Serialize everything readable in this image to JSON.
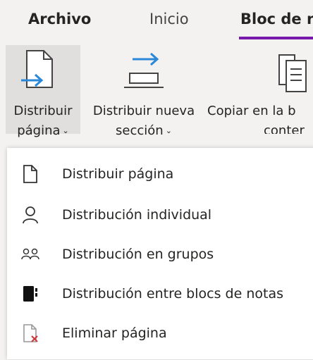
{
  "tabs": [
    {
      "label": "Archivo"
    },
    {
      "label": "Inicio"
    },
    {
      "label": "Bloc de n"
    }
  ],
  "ribbon": {
    "buttons": [
      {
        "line1": "Distribuir",
        "line2": "página",
        "icon": "distribute-page-icon"
      },
      {
        "line1": "Distribuir nueva",
        "line2": "sección",
        "icon": "distribute-section-icon"
      },
      {
        "line1": "Copiar en la b",
        "line2": "conter",
        "icon": "copy-notebook-icon"
      }
    ]
  },
  "menu": {
    "items": [
      {
        "label": "Distribuir página",
        "icon": "page-icon"
      },
      {
        "label": "Distribución individual",
        "icon": "person-icon"
      },
      {
        "label": "Distribución en grupos",
        "icon": "group-icon"
      },
      {
        "label": "Distribución entre blocs de notas",
        "icon": "notebook-icon"
      },
      {
        "label": "Eliminar página",
        "icon": "delete-page-icon"
      }
    ]
  },
  "colors": {
    "accent": "#7719aa",
    "arrow": "#2b88d8",
    "delete": "#d13438"
  }
}
